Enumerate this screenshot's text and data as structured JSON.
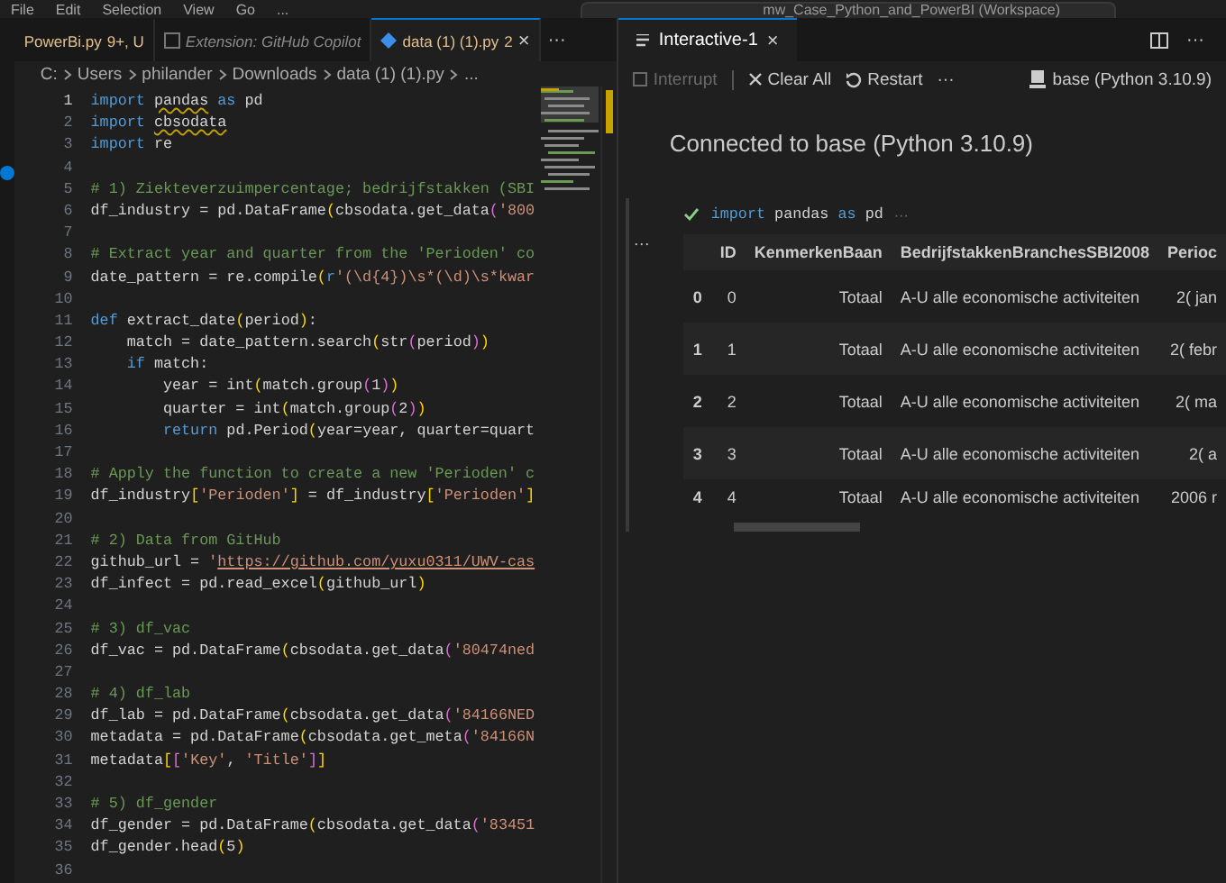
{
  "menu_bar": {
    "items": [
      "File",
      "Edit",
      "Selection",
      "View",
      "Go",
      "..."
    ],
    "search": "mw_Case_Python_and_PowerBI (Workspace)"
  },
  "editor": {
    "tabs": [
      {
        "label": "PowerBi.py",
        "badge": "9+, U",
        "selected": false,
        "italic": false
      },
      {
        "label": "Extension: GitHub Copilot",
        "selected": false,
        "italic": true
      },
      {
        "label": "data (1) (1).py",
        "badge": "2",
        "selected": true,
        "italic": false,
        "close": "×"
      }
    ],
    "tabs_more": "···",
    "breadcrumb": [
      "C:",
      "Users",
      "philander",
      "Downloads",
      "data (1) (1).py",
      "..."
    ],
    "lines": [
      {
        "number": "1",
        "active": true,
        "segments": [
          {
            "kind": "kw",
            "text": "import "
          },
          {
            "kind": "warn",
            "text": "pandas"
          },
          {
            "kind": "kw",
            "text": " as"
          },
          {
            "kind": "txt",
            "text": " pd"
          }
        ]
      },
      {
        "number": "2",
        "active": false,
        "segments": [
          {
            "kind": "kw",
            "text": "import "
          },
          {
            "kind": "warn",
            "text": "cbsodata"
          }
        ]
      },
      {
        "number": "3",
        "active": false,
        "segments": [
          {
            "kind": "kw",
            "text": "import"
          },
          {
            "kind": "txt",
            "text": " re"
          }
        ]
      },
      {
        "number": "4",
        "active": false
      },
      {
        "number": "5",
        "active": false,
        "segments": [
          {
            "kind": "cmt",
            "text": "# 1) Ziekteverzuimpercentage; bedrijfstakken (SBI"
          }
        ]
      },
      {
        "number": "6",
        "active": false,
        "segments": [
          {
            "kind": "txt",
            "text": "df_industry = pd.DataFrame"
          },
          {
            "kind": "br1",
            "text": "("
          },
          {
            "kind": "txt",
            "text": "cbsodata.get_data"
          },
          {
            "kind": "br2",
            "text": "("
          },
          {
            "kind": "str",
            "text": "'800"
          }
        ]
      },
      {
        "number": "7",
        "active": false
      },
      {
        "number": "8",
        "active": false,
        "segments": [
          {
            "kind": "cmt",
            "text": "# Extract year and quarter from the 'Perioden' co"
          }
        ]
      },
      {
        "number": "9",
        "active": false,
        "segments": [
          {
            "kind": "txt",
            "text": "date_pattern = re.compile"
          },
          {
            "kind": "br1",
            "text": "("
          },
          {
            "kind": "kw",
            "text": "r"
          },
          {
            "kind": "str",
            "text": "'(\\d{4})\\s*(\\d)\\s*kwar"
          }
        ]
      },
      {
        "number": "10",
        "active": false
      },
      {
        "number": "11",
        "active": false,
        "segments": [
          {
            "kind": "kw",
            "text": "def"
          },
          {
            "kind": "txt",
            "text": " extract_date"
          },
          {
            "kind": "br1",
            "text": "("
          },
          {
            "kind": "txt",
            "text": "period"
          },
          {
            "kind": "br1",
            "text": ")"
          },
          {
            "kind": "txt",
            "text": ":"
          }
        ]
      },
      {
        "number": "12",
        "active": false,
        "segments": [
          {
            "kind": "txt",
            "text": "    match = date_pattern.search"
          },
          {
            "kind": "br1",
            "text": "("
          },
          {
            "kind": "txt",
            "text": "str"
          },
          {
            "kind": "br2",
            "text": "("
          },
          {
            "kind": "txt",
            "text": "period"
          },
          {
            "kind": "br2",
            "text": ")"
          },
          {
            "kind": "br1",
            "text": ")"
          }
        ]
      },
      {
        "number": "13",
        "active": false,
        "segments": [
          {
            "kind": "kw",
            "text": "    if"
          },
          {
            "kind": "txt",
            "text": " match:"
          }
        ]
      },
      {
        "number": "14",
        "active": false,
        "segments": [
          {
            "kind": "txt",
            "text": "        year = int"
          },
          {
            "kind": "br1",
            "text": "("
          },
          {
            "kind": "txt",
            "text": "match.group"
          },
          {
            "kind": "br2",
            "text": "("
          },
          {
            "kind": "txt",
            "text": "1"
          },
          {
            "kind": "br2",
            "text": ")"
          },
          {
            "kind": "br1",
            "text": ")"
          }
        ]
      },
      {
        "number": "15",
        "active": false,
        "segments": [
          {
            "kind": "txt",
            "text": "        quarter = int"
          },
          {
            "kind": "br1",
            "text": "("
          },
          {
            "kind": "txt",
            "text": "match.group"
          },
          {
            "kind": "br2",
            "text": "("
          },
          {
            "kind": "txt",
            "text": "2"
          },
          {
            "kind": "br2",
            "text": ")"
          },
          {
            "kind": "br1",
            "text": ")"
          }
        ]
      },
      {
        "number": "16",
        "active": false,
        "segments": [
          {
            "kind": "kw",
            "text": "        return"
          },
          {
            "kind": "txt",
            "text": " pd.Period"
          },
          {
            "kind": "br1",
            "text": "("
          },
          {
            "kind": "txt",
            "text": "year=year, quarter=quart"
          }
        ]
      },
      {
        "number": "17",
        "active": false
      },
      {
        "number": "18",
        "active": false,
        "segments": [
          {
            "kind": "cmt",
            "text": "# Apply the function to create a new 'Perioden' c"
          }
        ]
      },
      {
        "number": "19",
        "active": false,
        "segments": [
          {
            "kind": "txt",
            "text": "df_industry"
          },
          {
            "kind": "br1",
            "text": "["
          },
          {
            "kind": "str",
            "text": "'Perioden'"
          },
          {
            "kind": "br1",
            "text": "]"
          },
          {
            "kind": "txt",
            "text": " = df_industry"
          },
          {
            "kind": "br1",
            "text": "["
          },
          {
            "kind": "str",
            "text": "'Perioden'"
          },
          {
            "kind": "br1",
            "text": "]"
          }
        ]
      },
      {
        "number": "20",
        "active": false
      },
      {
        "number": "21",
        "active": false,
        "segments": [
          {
            "kind": "cmt",
            "text": "# 2) Data from GitHub"
          }
        ]
      },
      {
        "number": "22",
        "active": false,
        "segments": [
          {
            "kind": "txt",
            "text": "github_url = "
          },
          {
            "kind": "str",
            "text": "'"
          },
          {
            "kind": "link",
            "text": "https://github.com/yuxu0311/UWV-cas"
          }
        ]
      },
      {
        "number": "23",
        "active": false,
        "segments": [
          {
            "kind": "txt",
            "text": "df_infect = pd.read_excel"
          },
          {
            "kind": "br1",
            "text": "("
          },
          {
            "kind": "txt",
            "text": "github_url"
          },
          {
            "kind": "br1",
            "text": ")"
          }
        ]
      },
      {
        "number": "24",
        "active": false
      },
      {
        "number": "25",
        "active": false,
        "segments": [
          {
            "kind": "cmt",
            "text": "# 3) df_vac"
          }
        ]
      },
      {
        "number": "26",
        "active": false,
        "segments": [
          {
            "kind": "txt",
            "text": "df_vac = pd.DataFrame"
          },
          {
            "kind": "br1",
            "text": "("
          },
          {
            "kind": "txt",
            "text": "cbsodata.get_data"
          },
          {
            "kind": "br2",
            "text": "("
          },
          {
            "kind": "str",
            "text": "'80474ned"
          }
        ]
      },
      {
        "number": "27",
        "active": false
      },
      {
        "number": "28",
        "active": false,
        "segments": [
          {
            "kind": "cmt",
            "text": "# 4) df_lab"
          }
        ]
      },
      {
        "number": "29",
        "active": false,
        "segments": [
          {
            "kind": "txt",
            "text": "df_lab = pd.DataFrame"
          },
          {
            "kind": "br1",
            "text": "("
          },
          {
            "kind": "txt",
            "text": "cbsodata.get_data"
          },
          {
            "kind": "br2",
            "text": "("
          },
          {
            "kind": "str",
            "text": "'84166NED"
          }
        ]
      },
      {
        "number": "30",
        "active": false,
        "segments": [
          {
            "kind": "txt",
            "text": "metadata = pd.DataFrame"
          },
          {
            "kind": "br1",
            "text": "("
          },
          {
            "kind": "txt",
            "text": "cbsodata.get_meta"
          },
          {
            "kind": "br2",
            "text": "("
          },
          {
            "kind": "str",
            "text": "'84166N"
          }
        ]
      },
      {
        "number": "31",
        "active": false,
        "segments": [
          {
            "kind": "txt",
            "text": "metadata"
          },
          {
            "kind": "br1",
            "text": "["
          },
          {
            "kind": "br2",
            "text": "["
          },
          {
            "kind": "str",
            "text": "'Key'"
          },
          {
            "kind": "txt",
            "text": ", "
          },
          {
            "kind": "str",
            "text": "'Title'"
          },
          {
            "kind": "br2",
            "text": "]"
          },
          {
            "kind": "br1",
            "text": "]"
          }
        ]
      },
      {
        "number": "32",
        "active": false
      },
      {
        "number": "33",
        "active": false,
        "segments": [
          {
            "kind": "cmt",
            "text": "# 5) df_gender"
          }
        ]
      },
      {
        "number": "34",
        "active": false,
        "segments": [
          {
            "kind": "txt",
            "text": "df_gender = pd.DataFrame"
          },
          {
            "kind": "br1",
            "text": "("
          },
          {
            "kind": "txt",
            "text": "cbsodata.get_data"
          },
          {
            "kind": "br2",
            "text": "("
          },
          {
            "kind": "str",
            "text": "'83451"
          }
        ]
      },
      {
        "number": "35",
        "active": false,
        "segments": [
          {
            "kind": "txt",
            "text": "df_gender.head"
          },
          {
            "kind": "br1",
            "text": "("
          },
          {
            "kind": "txt",
            "text": "5"
          },
          {
            "kind": "br1",
            "text": ")"
          }
        ]
      },
      {
        "number": "36",
        "active": false
      }
    ]
  },
  "interactive": {
    "tab": {
      "label": "Interactive-1",
      "close": "×"
    },
    "more": "···",
    "toolbar": [
      {
        "label": "Interrupt",
        "disabled": true,
        "kind": "interrupt"
      },
      {
        "label": "Clear All",
        "disabled": false,
        "kind": "clear"
      },
      {
        "label": "Restart",
        "disabled": false,
        "kind": "restart"
      },
      {
        "label": "···",
        "disabled": false,
        "kind": "more"
      }
    ],
    "kernel": "base (Python 3.10.9)",
    "status": "Connected to base (Python 3.10.9)",
    "cell": {
      "segments": [
        {
          "kind": "kw",
          "text": "import"
        },
        {
          "kind": "txt",
          "text": " pandas "
        },
        {
          "kind": "kw",
          "text": "as"
        },
        {
          "kind": "txt",
          "text": " pd"
        }
      ],
      "ellipsis": "···",
      "output_more": "···"
    },
    "table": {
      "columns": [
        "",
        "ID",
        "KenmerkenBaan",
        "BedrijfstakkenBranchesSBI2008",
        "Perioc"
      ],
      "rows": [
        [
          "0",
          "0",
          "Totaal",
          "A-U alle economische activiteiten",
          "2( jan"
        ],
        [
          "1",
          "1",
          "Totaal",
          "A-U alle economische activiteiten",
          "2( febr"
        ],
        [
          "2",
          "2",
          "Totaal",
          "A-U alle economische activiteiten",
          "2( ma"
        ],
        [
          "3",
          "3",
          "Totaal",
          "A-U alle economische activiteiten",
          "2( a"
        ],
        [
          "4",
          "4",
          "Totaal",
          "A-U alle economische activiteiten",
          "2006 r"
        ]
      ]
    }
  }
}
